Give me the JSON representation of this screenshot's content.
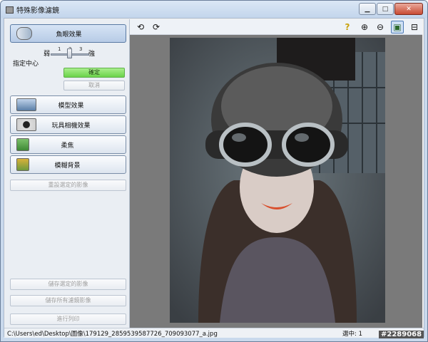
{
  "window": {
    "title": "特殊影像濾鏡",
    "caption_buttons": [
      "minimize-icon",
      "maximize-icon",
      "close-icon"
    ]
  },
  "panel": {
    "fisheye_button": "魚眼效果",
    "slider": {
      "weak": "弱",
      "strong": "強",
      "ticks": [
        "1",
        "2",
        "3"
      ],
      "value": 2
    },
    "center_label": "指定中心",
    "ok_button": "確定",
    "cancel_button": "取消",
    "miniature_button": "模型效果",
    "toycamera_button": "玩具相機效果",
    "softfocus_button": "柔焦",
    "blur_bg_button": "模糊背景",
    "reset_button": "重設選定的影像",
    "save_selected": "儲存選定的影像",
    "save_all": "儲存所有濾鏡影像",
    "print": "進行列印"
  },
  "toolbar": {
    "icons": [
      "rotate-left-icon",
      "rotate-right-icon",
      "help-icon",
      "zoom-in-icon",
      "zoom-out-icon",
      "fit-image-icon",
      "full-screen-icon"
    ],
    "help_glyph": "?"
  },
  "status": {
    "path": "C:\\Users\\ed\\Desktop\\圖像\\179129_2859539587726_709093077_a.jpg",
    "selected": "選中: 1"
  },
  "watermark": "#2289068"
}
